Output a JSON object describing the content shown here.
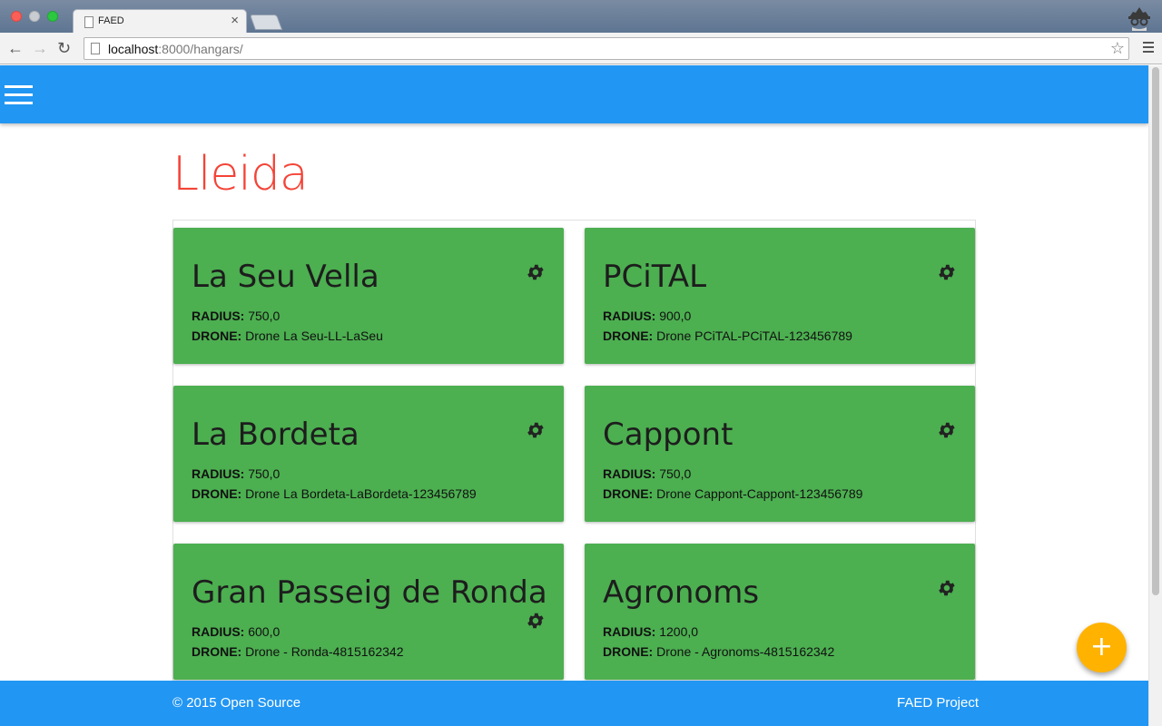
{
  "browser": {
    "tab_title": "FAED",
    "tab_close": "×",
    "url_host": "localhost",
    "url_path": ":8000/hangars/"
  },
  "page": {
    "title": "Lleida",
    "radius_label": "RADIUS:",
    "drone_label": "DRONE:"
  },
  "hangars": [
    {
      "name": "La Seu Vella",
      "radius": "750,0",
      "drone": "Drone La Seu-LL-LaSeu"
    },
    {
      "name": "PCiTAL",
      "radius": "900,0",
      "drone": "Drone PCiTAL-PCiTAL-123456789"
    },
    {
      "name": "La Bordeta",
      "radius": "750,0",
      "drone": "Drone La Bordeta-LaBordeta-123456789"
    },
    {
      "name": "Cappont",
      "radius": "750,0",
      "drone": "Drone Cappont-Cappont-123456789"
    },
    {
      "name": "Gran Passeig de Ronda",
      "radius": "600,0",
      "drone": "Drone - Ronda-4815162342"
    },
    {
      "name": "Agronoms",
      "radius": "1200,0",
      "drone": "Drone - Agronoms-4815162342"
    }
  ],
  "footer": {
    "left": "© 2015 Open Source",
    "right": "FAED Project"
  },
  "fab": {
    "label": "+"
  },
  "colors": {
    "appbar": "#2196f3",
    "card": "#4caf50",
    "title": "#f44336",
    "fab": "#ffb300"
  }
}
